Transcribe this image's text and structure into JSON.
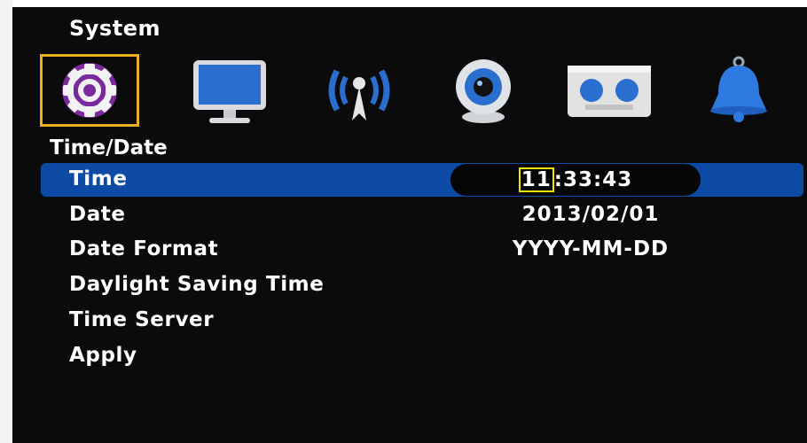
{
  "header": {
    "title": "System"
  },
  "icons": [
    {
      "name": "gear-icon"
    },
    {
      "name": "monitor-icon"
    },
    {
      "name": "network-icon"
    },
    {
      "name": "webcam-icon"
    },
    {
      "name": "storage-icon"
    },
    {
      "name": "bell-icon"
    }
  ],
  "section": {
    "title": "Time/Date"
  },
  "settings": {
    "time": {
      "label": "Time",
      "hour": "11",
      "rest": ":33:43"
    },
    "date": {
      "label": "Date",
      "value": "2013/02/01"
    },
    "date_format": {
      "label": "Date Format",
      "value": "YYYY-MM-DD"
    },
    "dst": {
      "label": "Daylight Saving Time"
    },
    "time_server": {
      "label": "Time Server"
    },
    "apply": {
      "label": "Apply"
    }
  },
  "colors": {
    "selection": "#0d4aa6",
    "focus": "#f2e600",
    "icon_frame": "#e8b01e"
  }
}
